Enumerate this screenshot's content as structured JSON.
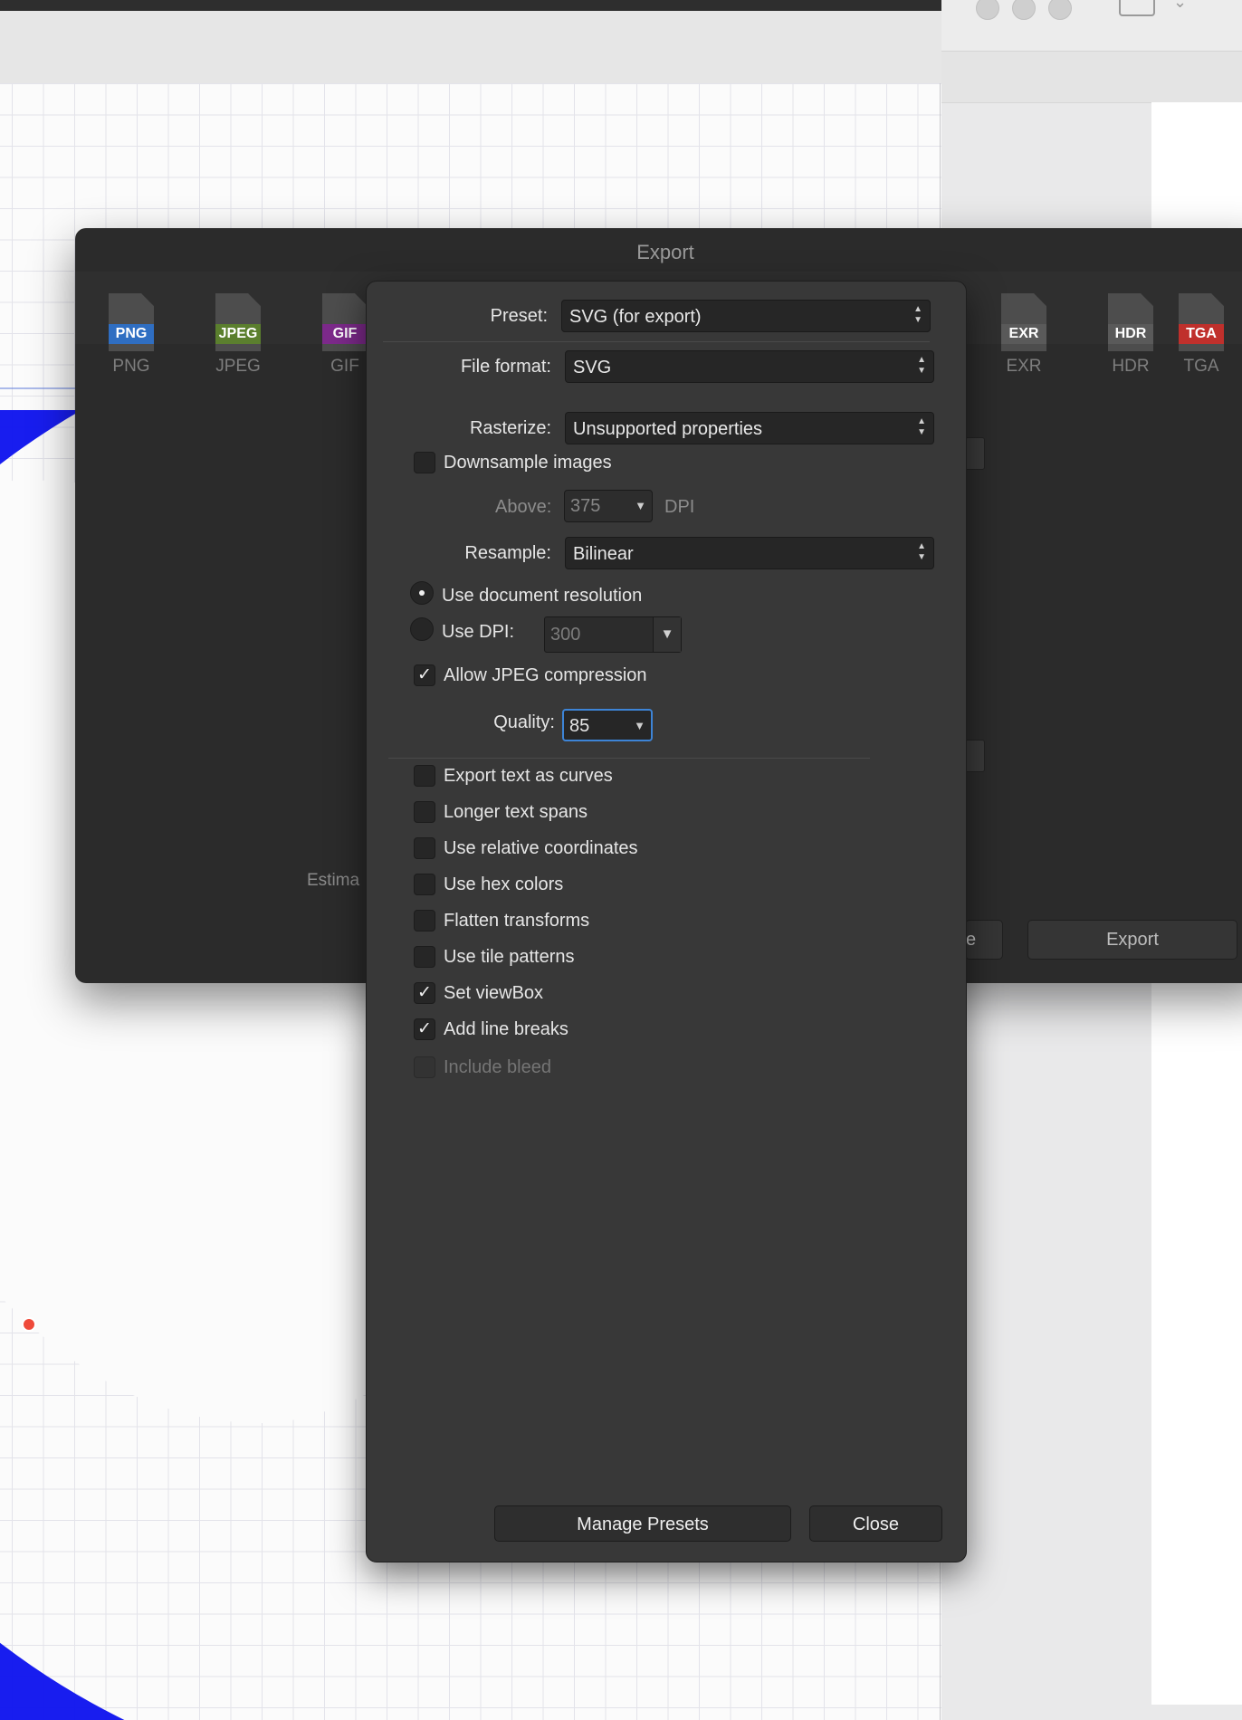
{
  "export_dialog": {
    "title": "Export",
    "formats": [
      {
        "tag": "PNG",
        "label": "PNG",
        "color": "#2f6ec2"
      },
      {
        "tag": "JPEG",
        "label": "JPEG",
        "color": "#5b7f2e"
      },
      {
        "tag": "GIF",
        "label": "GIF",
        "color": "#7d2a8b"
      },
      {
        "tag": "EXR",
        "label": "EXR",
        "color": "#5a5a5a"
      },
      {
        "tag": "HDR",
        "label": "HDR",
        "color": "#5a5a5a"
      },
      {
        "tag": "TGA",
        "label": "TGA",
        "color": "#c0302c"
      }
    ],
    "estimate_label": "Estima",
    "partial_button_label": "e",
    "export_button_label": "Export"
  },
  "panel": {
    "preset_label": "Preset:",
    "preset_value": "SVG (for export)",
    "file_format_label": "File format:",
    "file_format_value": "SVG",
    "rasterize_label": "Rasterize:",
    "rasterize_value": "Unsupported properties",
    "downsample_label": "Downsample images",
    "above_label": "Above:",
    "above_value": "375",
    "dpi_unit": "DPI",
    "resample_label": "Resample:",
    "resample_value": "Bilinear",
    "use_doc_resolution_label": "Use document resolution",
    "use_dpi_label": "Use DPI:",
    "use_dpi_value": "300",
    "allow_jpeg_label": "Allow JPEG compression",
    "quality_label": "Quality:",
    "quality_value": "85",
    "options": [
      {
        "label": "Export text as curves",
        "checked": false
      },
      {
        "label": "Longer text spans",
        "checked": false
      },
      {
        "label": "Use relative coordinates",
        "checked": false
      },
      {
        "label": "Use hex colors",
        "checked": false
      },
      {
        "label": "Flatten transforms",
        "checked": false
      },
      {
        "label": "Use tile patterns",
        "checked": false
      },
      {
        "label": "Set viewBox",
        "checked": true
      },
      {
        "label": "Add line breaks",
        "checked": true
      },
      {
        "label": "Include bleed",
        "checked": false,
        "disabled": true
      }
    ],
    "manage_presets_label": "Manage Presets",
    "close_label": "Close"
  },
  "colors": {
    "shape_blue": "#0f14ee",
    "anchor_red": "#ef4a3a",
    "focus_blue": "#3d84d6"
  }
}
